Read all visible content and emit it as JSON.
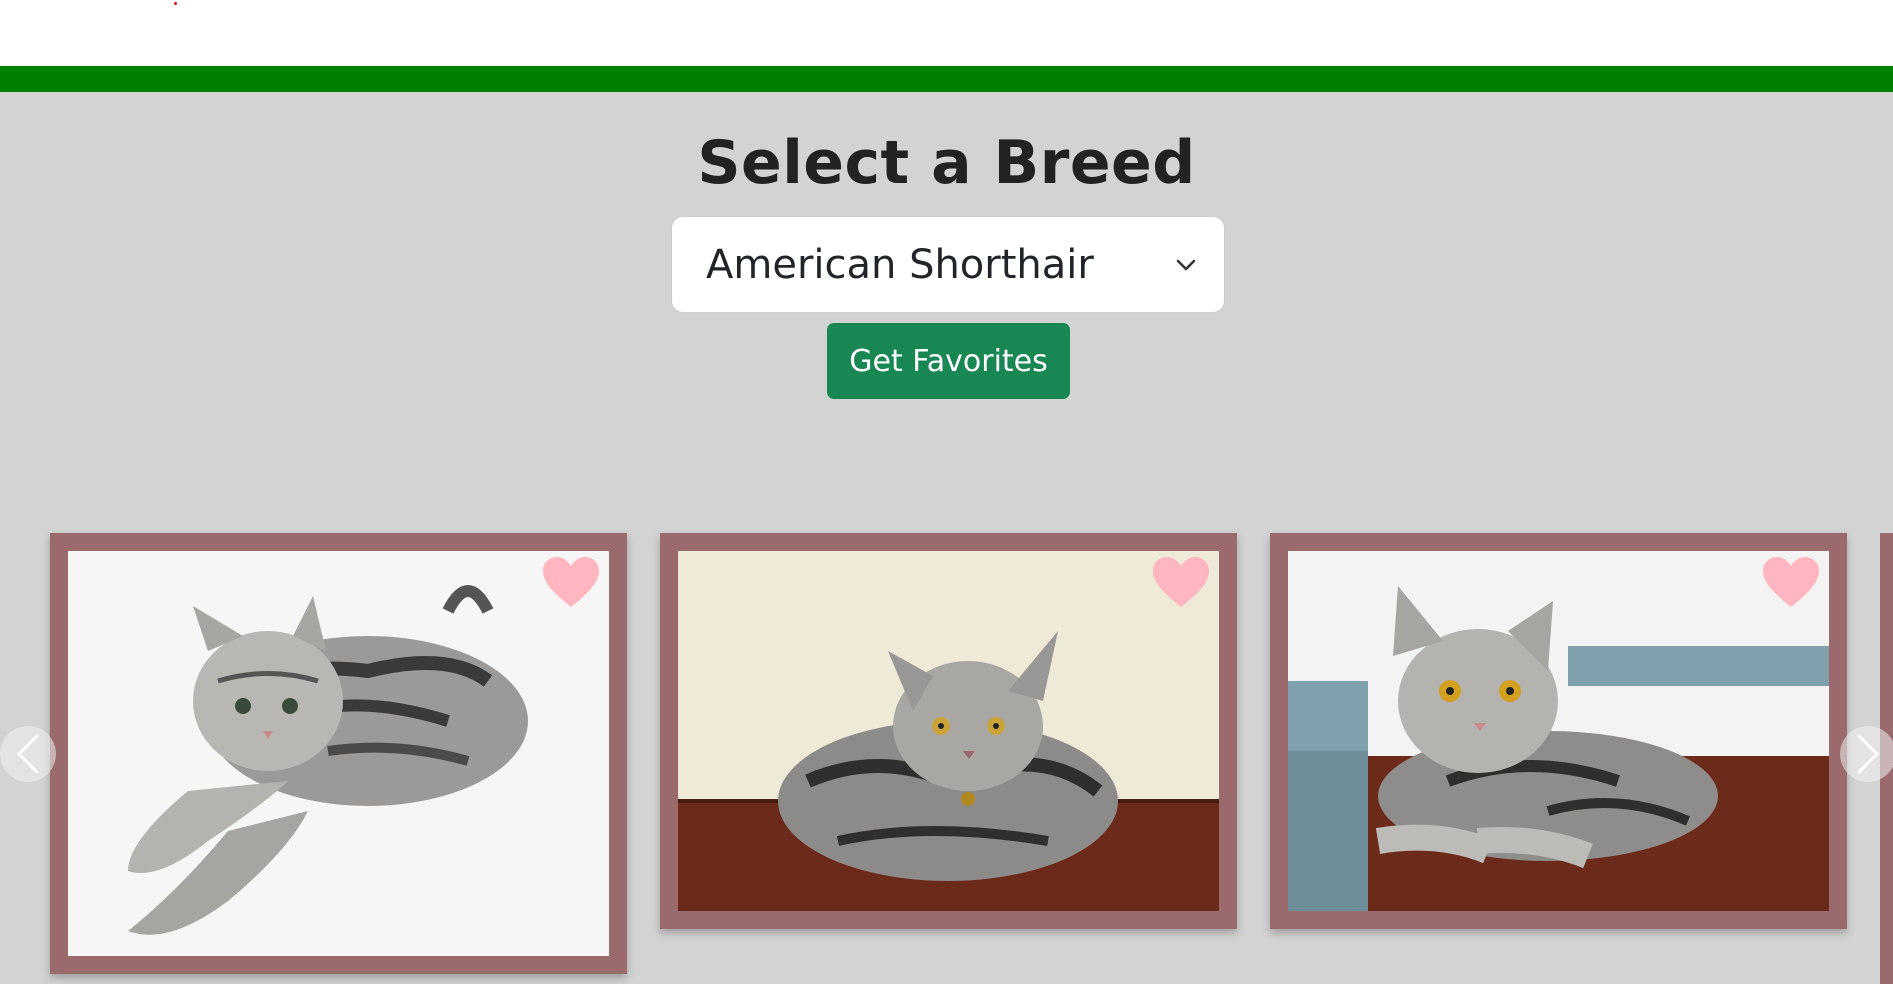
{
  "header": {
    "accent_color": "#008000"
  },
  "main": {
    "title": "Select a Breed",
    "breed_select": {
      "value": "American Shorthair",
      "icon": "chevron-down-icon"
    },
    "get_favorites_label": "Get Favorites",
    "button_color": "#198754"
  },
  "carousel": {
    "prev_icon": "chevron-left-icon",
    "next_icon": "chevron-right-icon",
    "cards": [
      {
        "subject": "silver tabby cat lying on white background",
        "favorite_icon": "heart-icon"
      },
      {
        "subject": "silver tabby cat sitting on wooden table",
        "favorite_icon": "heart-icon"
      },
      {
        "subject": "silver tabby cat lying on wooden floor",
        "favorite_icon": "heart-icon"
      }
    ],
    "card_border_color": "#9a6a6d",
    "heart_color": "#ffb6c1"
  }
}
